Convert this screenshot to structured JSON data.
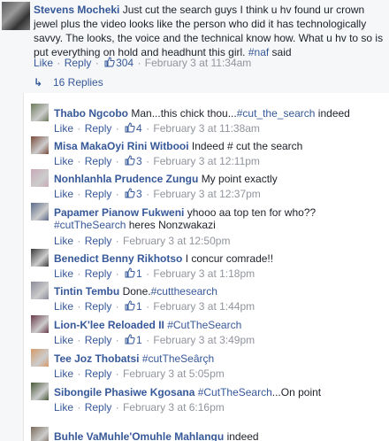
{
  "main_comment": {
    "author": "Stevens Mocheki",
    "text": "Just cut the search guys I think u hv found ur crown jewel plus the video looks like the person who did it has technologically savvy. The looks, the voice and the technical know how. What u hv to so is put everything on hold and headhunt this girl.",
    "hashtag": "#naf",
    "text_end": " said",
    "like_label": "Like",
    "reply_label": "Reply",
    "likes": "304",
    "time": "February 3 at 11:34am"
  },
  "replies_toggle": {
    "label": "16 Replies"
  },
  "replies": [
    {
      "author": "Thabo Ngcobo",
      "text": "Man...this chick thou...",
      "tag": "#cut_the_search",
      "text2": " indeed",
      "like_label": "Like",
      "reply_label": "Reply",
      "likes": "4",
      "time": "February 3 at 11:38am",
      "avatar_color": "#6b7a5a"
    },
    {
      "author": "Misa MakaOyi Rini Witbooi",
      "text": "Indeed # cut the search",
      "tag": "",
      "text2": "",
      "like_label": "Like",
      "reply_label": "Reply",
      "likes": "3",
      "time": "February 3 at 12:11pm",
      "avatar_color": "#7a4b3a"
    },
    {
      "author": "Nonhlanhla Prudence Zungu",
      "text": "My point exactly",
      "tag": "",
      "text2": "",
      "like_label": "Like",
      "reply_label": "Reply",
      "likes": "3",
      "time": "February 3 at 12:37pm",
      "avatar_color": "#c9a9b7"
    },
    {
      "author": "Papamer Pianow Fukweni",
      "text": "yhooo aa top ten for who??",
      "tag": "#cutTheSearch",
      "text2": " heres Nonzwakazi",
      "like_label": "Like",
      "reply_label": "Reply",
      "likes": "",
      "time": "February 3 at 12:50pm",
      "avatar_color": "#5a6a8a"
    },
    {
      "author": "Benedict Benny Rikhotso",
      "text": "I concur comrade!!",
      "tag": "",
      "text2": "",
      "like_label": "Like",
      "reply_label": "Reply",
      "likes": "1",
      "time": "February 3 at 1:18pm",
      "avatar_color": "#3a3a3a"
    },
    {
      "author": "Tintin Tembu",
      "text": "Done.",
      "tag": "#cutthesearch",
      "text2": "",
      "like_label": "Like",
      "reply_label": "Reply",
      "likes": "1",
      "time": "February 3 at 1:44pm",
      "avatar_color": "#8a8a9a"
    },
    {
      "author": "Lion-K'lee Reloaded II",
      "text": "",
      "tag": "#CutTheSearch",
      "text2": "",
      "like_label": "Like",
      "reply_label": "Reply",
      "likes": "1",
      "time": "February 3 at 3:49pm",
      "avatar_color": "#6a3a4a"
    },
    {
      "author": "Tee Joz Thobatsi",
      "text": "",
      "tag": "#cutTheSeârçh",
      "text2": "",
      "like_label": "Like",
      "reply_label": "Reply",
      "likes": "",
      "time": "February 3 at 5:05pm",
      "avatar_color": "#d49a6a"
    },
    {
      "author": "Sibongile Phasiwe Kgosana",
      "text": "",
      "tag": "#CutTheSearch",
      "text2": "...On point",
      "like_label": "Like",
      "reply_label": "Reply",
      "likes": "",
      "time": "February 3 at 6:16pm",
      "avatar_color": "#4a5a3a"
    },
    {
      "author": "Buhle VaMuhle'Omuhle Mahlangu",
      "text": "indeed",
      "tag": "",
      "text2": "",
      "like_label": "",
      "reply_label": "",
      "likes": "",
      "time": "",
      "avatar_color": "#7a6a5a"
    }
  ]
}
